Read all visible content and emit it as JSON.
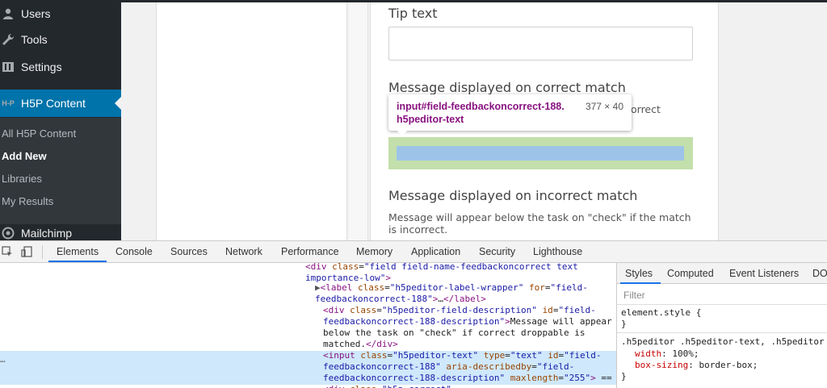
{
  "sidebar": {
    "items": [
      {
        "label": "Users",
        "icon": "users-icon"
      },
      {
        "label": "Tools",
        "icon": "wrench-icon"
      },
      {
        "label": "Settings",
        "icon": "settings-icon"
      },
      {
        "label": "H5P Content",
        "icon": "h5p-icon"
      },
      {
        "label": "Mailchimp",
        "icon": "mailchimp-icon"
      }
    ],
    "submenu": [
      "All H5P Content",
      "Add New",
      "Libraries",
      "My Results"
    ],
    "h5p_badge": "H-P"
  },
  "form": {
    "tip_label": "Tip text",
    "correct_label": "Message displayed on correct match",
    "correct_desc_tail": "orrect",
    "incorrect_label": "Message displayed on incorrect match",
    "incorrect_desc": "Message will appear below the task on \"check\" if the match is incorrect."
  },
  "tooltip": {
    "tag": "input",
    "id": "#field-feedbackoncorrect-188.",
    "class": "h5peditor-text",
    "dims": "377 × 40"
  },
  "devtools": {
    "tabs": [
      "Elements",
      "Console",
      "Sources",
      "Network",
      "Performance",
      "Memory",
      "Application",
      "Security",
      "Lighthouse"
    ],
    "active_tab": "Elements",
    "styles_tabs": [
      "Styles",
      "Computed",
      "Event Listeners",
      "DOI"
    ],
    "filter_placeholder": "Filter",
    "element_style": "element.style {",
    "close_brace": "}",
    "rule_selector": ".h5peditor .h5peditor-text, .h5peditor",
    "rule_props": [
      {
        "name": "width",
        "value": "100%;"
      },
      {
        "name": "box-sizing",
        "value": "border-box;"
      }
    ]
  },
  "colors": {
    "wp_sidebar": "#23282d",
    "wp_active": "#0073aa",
    "highlight_padding": "#c3dfab",
    "highlight_content": "#9dc4e8",
    "devtools_accent": "#1a73e8"
  }
}
